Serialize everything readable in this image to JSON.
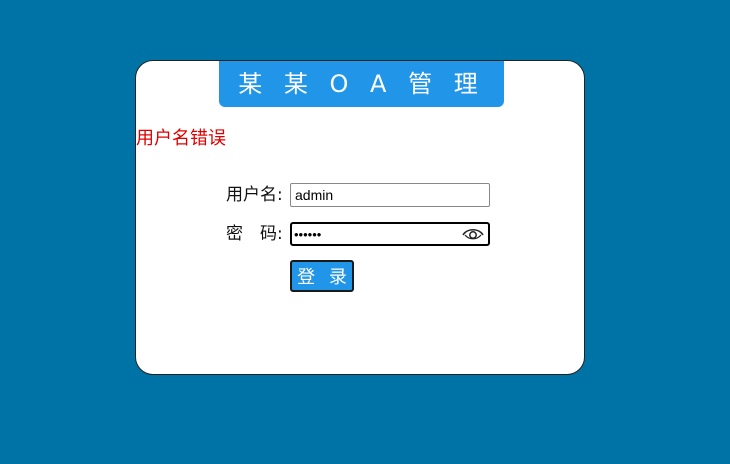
{
  "app": {
    "title": "某 某 O A 管 理 系 统"
  },
  "error": {
    "message": "用户名错误"
  },
  "form": {
    "username_label": "用户名:",
    "username_value": "admin",
    "password_label_1": "密",
    "password_label_2": "码:",
    "password_value": "secret",
    "submit_label": "登 录"
  },
  "icons": {
    "password_toggle": "eye-icon"
  },
  "colors": {
    "background": "#0073a6",
    "accent": "#2196e8",
    "error": "#e00000"
  }
}
